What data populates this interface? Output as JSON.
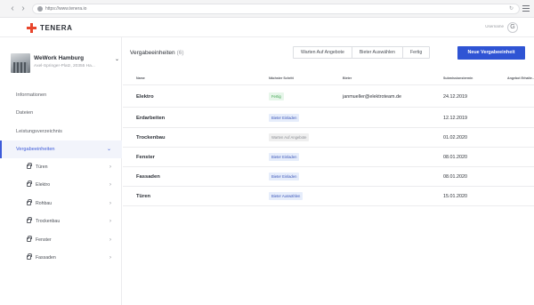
{
  "browser": {
    "back": "‹",
    "forward": "›",
    "url": "https://www.tenera.io",
    "reload": "↻"
  },
  "app": {
    "brand": "TENERA",
    "brand_color": "#e8452c",
    "user_name": "Username",
    "user_initial": "G"
  },
  "project": {
    "name": "WeWork Hamburg",
    "address": "Axel-Springer-Platz, 20355 Ha..."
  },
  "sidebar": {
    "items": [
      {
        "label": "Informationen"
      },
      {
        "label": "Dateien"
      },
      {
        "label": "Leistungsverzeichnis"
      },
      {
        "label": "Vergabeeinheiten",
        "arrow": "⌄"
      }
    ],
    "sub_items": [
      {
        "label": "Türen"
      },
      {
        "label": "Elektro"
      },
      {
        "label": "Rohbau"
      },
      {
        "label": "Trockenbau"
      },
      {
        "label": "Fenster"
      },
      {
        "label": "Fassaden"
      }
    ]
  },
  "main": {
    "title": "Vergabeeinheiten",
    "count": "(6)",
    "filters": [
      "Warten Auf Angebote",
      "Bieter Auswählen",
      "Fertig"
    ],
    "new_button": "Neue Vergabeeinheit",
    "accent_color": "#2f54d4"
  },
  "table": {
    "headers": [
      "Name",
      "Nächster Schritt",
      "Bieter",
      "Submissionstermin",
      "Angebot Erhalte..."
    ],
    "rows": [
      {
        "name": "Elektro",
        "step": "Fertig",
        "step_type": "done",
        "bieter": "janmueller@elektroteam.de",
        "date": "24.12.2019"
      },
      {
        "name": "Erdarbeiten",
        "step": "Bieter Einladen",
        "step_type": "invite",
        "bieter": "",
        "date": "12.12.2019"
      },
      {
        "name": "Trockenbau",
        "step": "Warten Auf Angebote",
        "step_type": "wait",
        "bieter": "",
        "date": "01.02.2020"
      },
      {
        "name": "Fenster",
        "step": "Bieter Einladen",
        "step_type": "invite",
        "bieter": "",
        "date": "08.01.2020"
      },
      {
        "name": "Fassaden",
        "step": "Bieter Einladen",
        "step_type": "invite",
        "bieter": "",
        "date": "08.01.2020"
      },
      {
        "name": "Türen",
        "step": "Bieter Auswählen",
        "step_type": "invite",
        "bieter": "",
        "date": "15.01.2020"
      }
    ]
  }
}
